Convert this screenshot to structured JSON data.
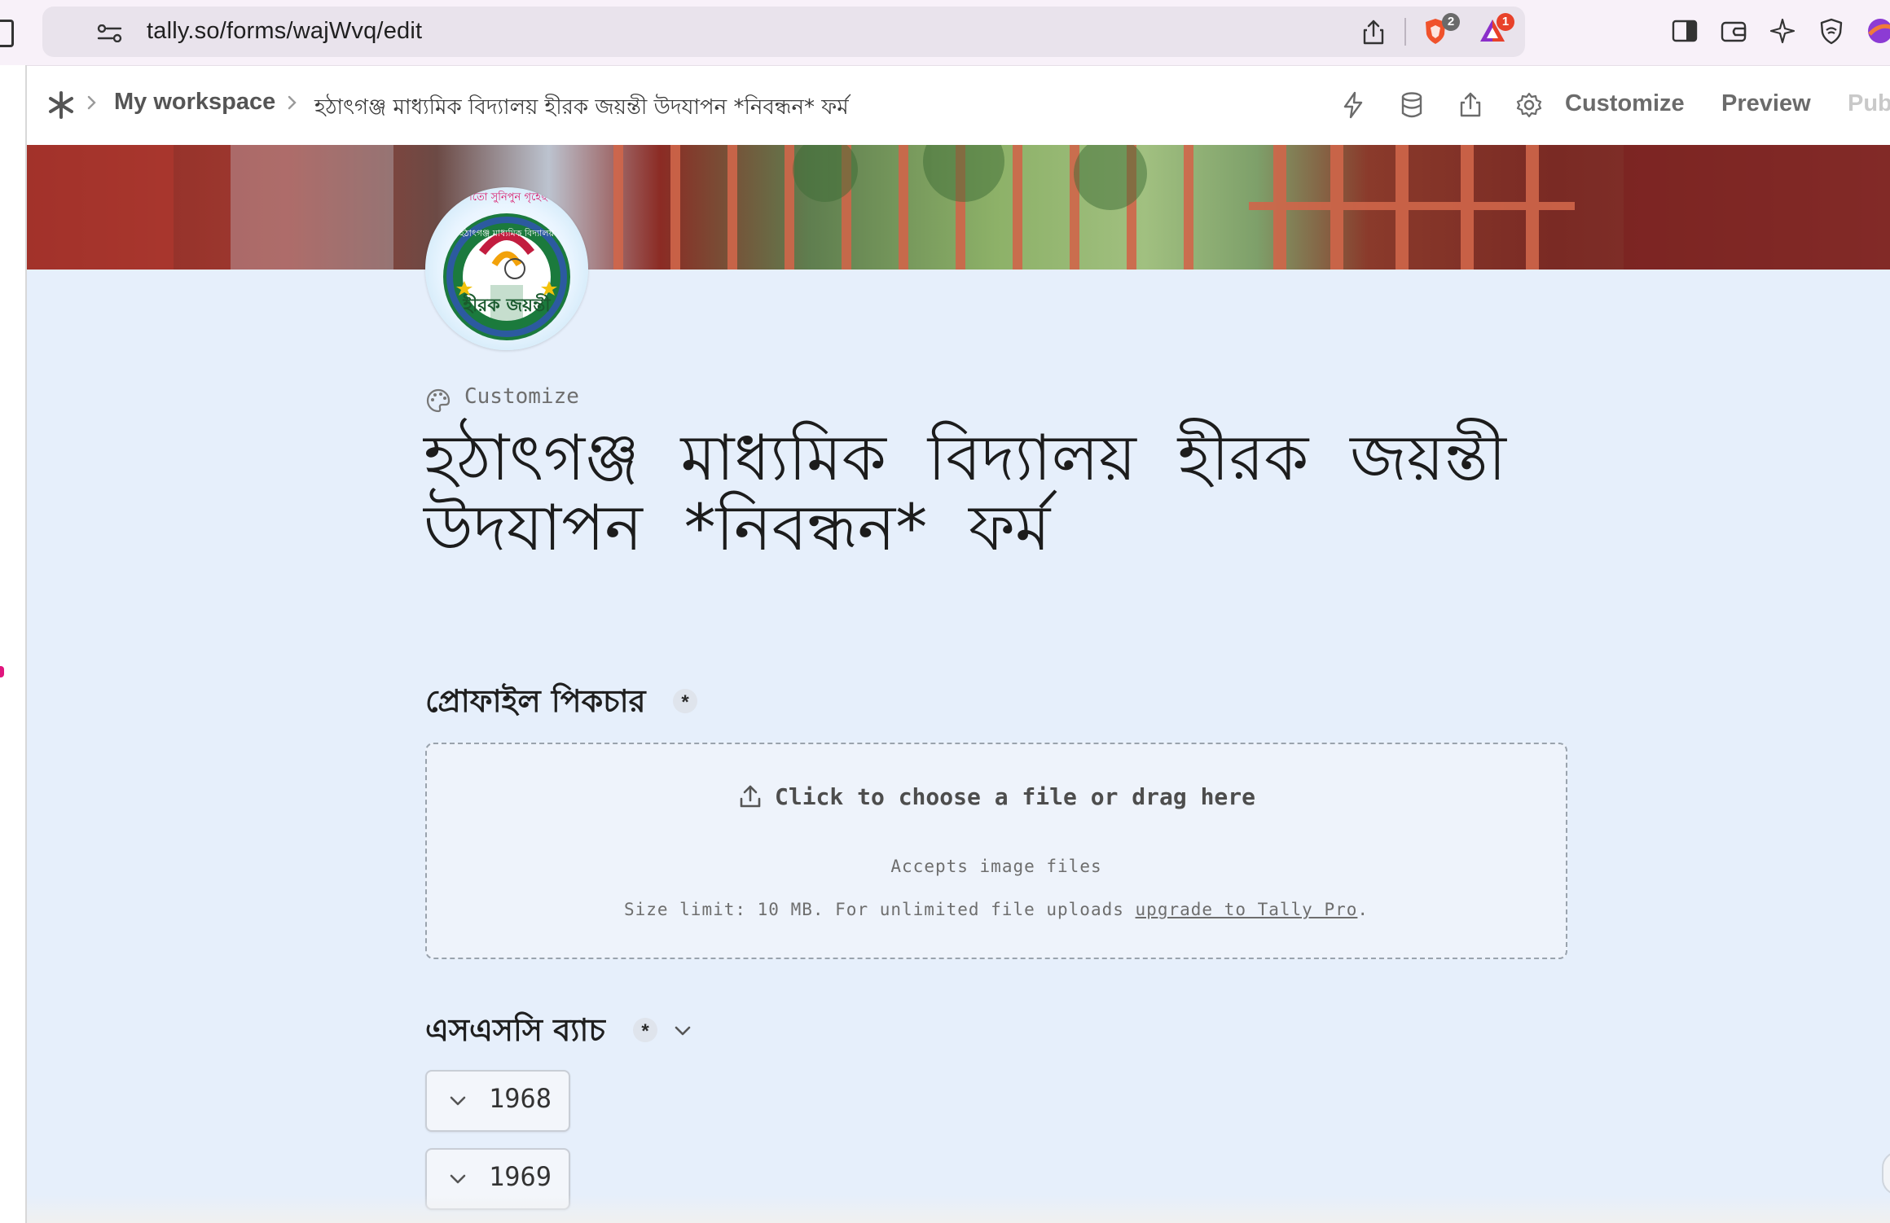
{
  "browser": {
    "url": "tally.so/forms/wajWvq/edit",
    "brave_badge": "2",
    "rewards_badge": "1"
  },
  "topbar": {
    "workspace": "My workspace",
    "form_title": "হঠাৎগঞ্জ মাধ্যমিক বিদ্যালয় হীরক জয়ন্তী উদযাপন *নিবন্ধন* ফর্ম",
    "customize_label": "Customize",
    "preview_label": "Preview",
    "publish_label": "Pub"
  },
  "form": {
    "avatar_text_top": "হঠাৎগঞ্জ মাধ্যমিক বিদ্যালয়",
    "avatar_text_main": "হীরক জয়ন্তী",
    "avatar_text_ribbon": "শতো সুনিপুন গৃহেছ",
    "customize_link": "Customize",
    "title": "হঠাৎগঞ্জ মাধ্যমিক বিদ্যালয় হীরক জয়ন্তী উদযাপন *নিবন্ধন* ফর্ম",
    "questions": [
      {
        "label": "প্রোফাইল পিকচার",
        "required_mark": "*",
        "upload_text": "Click to choose a file or drag here",
        "accepts_text": "Accepts image files",
        "size_limit_text": "Size limit: 10 MB. For unlimited file uploads ",
        "upgrade_link": "upgrade to Tally Pro",
        "size_limit_end": "."
      },
      {
        "label": "এসএসসি ব্যাচ",
        "required_mark": "*",
        "options": [
          "1968",
          "1969"
        ]
      }
    ]
  },
  "colors": {
    "form_background": "#e6effb",
    "topbar_text": "#6b6b6b",
    "brave_orange": "#f0522b",
    "badge_red": "#e8412a"
  }
}
